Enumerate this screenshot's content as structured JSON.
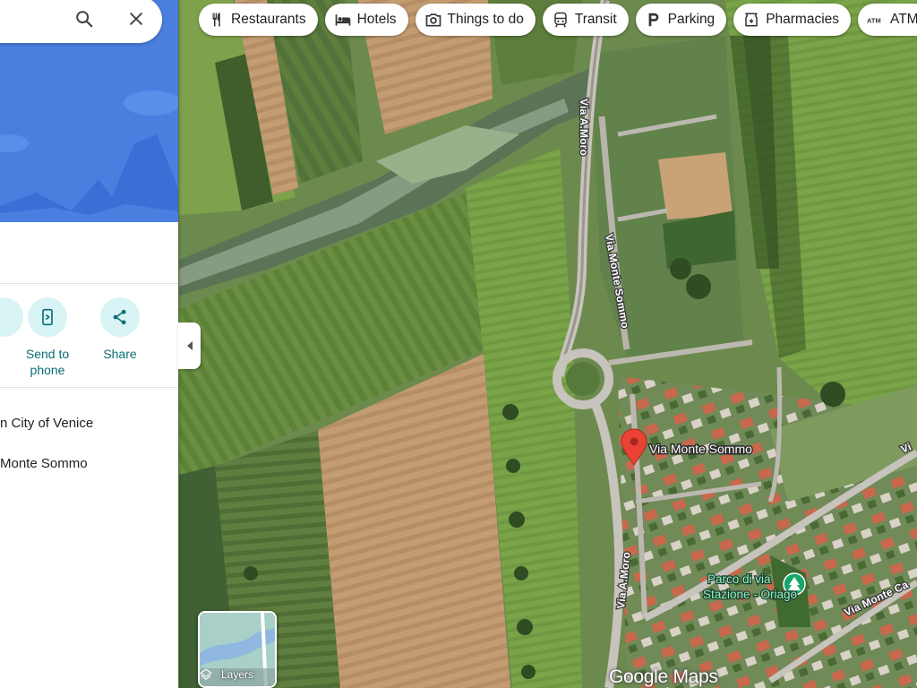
{
  "search": {
    "search_icon": "search-icon",
    "close_icon": "close-icon"
  },
  "chips": [
    {
      "label": "Restaurants",
      "icon": "restaurant-icon"
    },
    {
      "label": "Hotels",
      "icon": "hotel-icon"
    },
    {
      "label": "Things to do",
      "icon": "camera-icon"
    },
    {
      "label": "Transit",
      "icon": "transit-icon"
    },
    {
      "label": "Parking",
      "icon": "parking-icon"
    },
    {
      "label": "Pharmacies",
      "icon": "pharmacy-icon"
    },
    {
      "label": "ATMs",
      "icon": "atm-icon"
    }
  ],
  "panel": {
    "actions": [
      {
        "label": "Send to\nphone",
        "icon": "send-to-phone-icon"
      },
      {
        "label": "Share",
        "icon": "share-icon"
      }
    ],
    "info_lines": [
      "n City of Venice",
      "Monte Sommo"
    ]
  },
  "map": {
    "roads": [
      "Via A.Moro",
      "Via Monte Sommo",
      "Via A.Moro",
      "Via Monte Ca",
      "Vi"
    ],
    "pin_label": "Via Monte Sommo",
    "park_label_line1": "Parco di via",
    "park_label_line2": "Stazione - Oriago"
  },
  "layers": {
    "label": "Layers"
  },
  "logo": "Google Maps",
  "colors": {
    "accent": "#0a6d74",
    "action_bg": "#d8f4f5",
    "pin": "#ea4335",
    "hero_blue": "#4a7fe0"
  }
}
